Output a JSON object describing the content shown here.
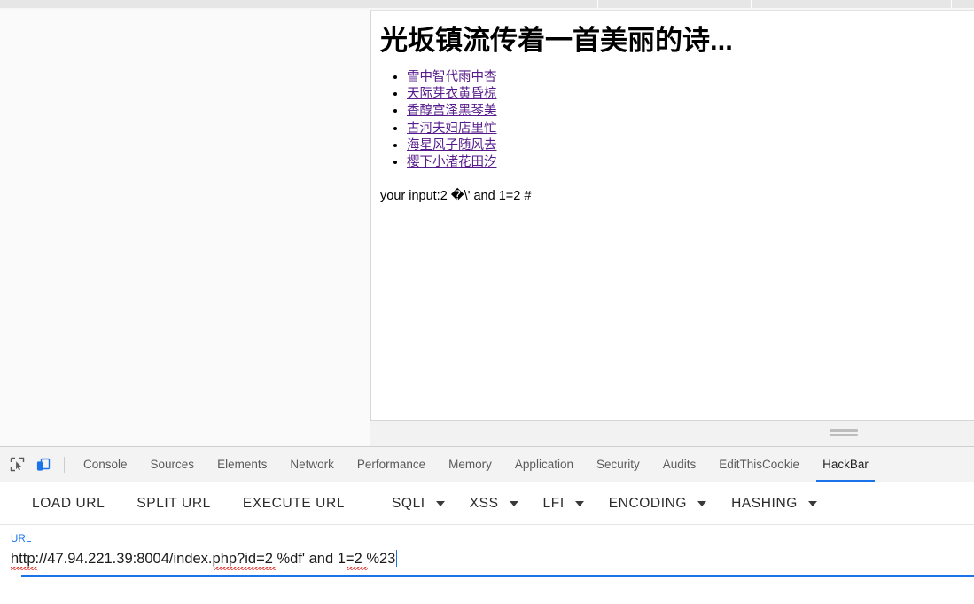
{
  "browser": {
    "tab_separator_positions": [
      391,
      674,
      847,
      1073,
      1110,
      1148
    ]
  },
  "page": {
    "title": "光坂镇流传着一首美丽的诗...",
    "links": [
      "雪中智代雨中杏",
      "天际芽衣黄昏椋",
      "香醇宫泽黑琴美",
      "古河夫妇店里忙",
      "海星风子随风去",
      "樱下小渚花田汐"
    ],
    "output_text": "your input:2 �\\' and 1=2 #",
    "link_color": "#551a8b"
  },
  "devtools": {
    "icons": {
      "inspect": "inspect-element-icon",
      "device": "device-toolbar-icon"
    },
    "tabs": [
      {
        "label": "Console",
        "active": false
      },
      {
        "label": "Sources",
        "active": false
      },
      {
        "label": "Elements",
        "active": false
      },
      {
        "label": "Network",
        "active": false
      },
      {
        "label": "Performance",
        "active": false
      },
      {
        "label": "Memory",
        "active": false
      },
      {
        "label": "Application",
        "active": false
      },
      {
        "label": "Security",
        "active": false
      },
      {
        "label": "Audits",
        "active": false
      },
      {
        "label": "EditThisCookie",
        "active": false
      },
      {
        "label": "HackBar",
        "active": true
      }
    ],
    "active_tab": "HackBar",
    "active_tab_accent": "#1a73e8",
    "resize_handle": "devtools-resize-handle"
  },
  "hackbar": {
    "buttons": [
      {
        "label": "LOAD URL"
      },
      {
        "label": "SPLIT URL"
      },
      {
        "label": "EXECUTE URL"
      }
    ],
    "menus": [
      {
        "label": "SQLI"
      },
      {
        "label": "XSS"
      },
      {
        "label": "LFI"
      },
      {
        "label": "ENCODING"
      },
      {
        "label": "HASHING"
      }
    ],
    "url_field": {
      "label": "URL",
      "value": "http://47.94.221.39:8004/index.php?id=2 %df' and 1=2 %23",
      "placeholder": "URL",
      "focused": true,
      "accent_color": "#1a73e8",
      "spellcheck_marks": [
        "http",
        "index.php",
        "%df"
      ]
    }
  }
}
